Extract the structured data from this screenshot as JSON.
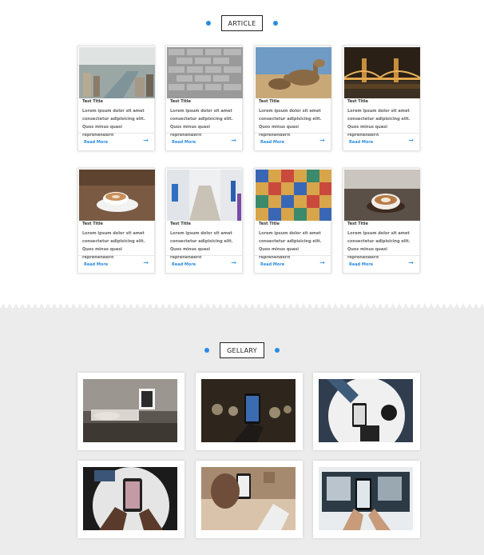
{
  "article_section": {
    "title": "ARTICLE"
  },
  "article_cards": [
    {
      "image": "city-river-photo",
      "title": "Test Title",
      "text": "Lorem ipsum dolor sit amet consectetur adipisicing elit. Quos minus quasi reprehenderit",
      "link": "Read More"
    },
    {
      "image": "brick-wall-photo",
      "title": "Test Title",
      "text": "Lorem ipsum dolor sit amet consectetur adipisicing elit. Quos minus quasi reprehenderit",
      "link": "Read More"
    },
    {
      "image": "camels-desert-photo",
      "title": "Test Title",
      "text": "Lorem ipsum dolor sit amet consectetur adipisicing elit. Quos minus quasi reprehenderit",
      "link": "Read More"
    },
    {
      "image": "bridge-night-photo",
      "title": "Test Title",
      "text": "Lorem ipsum dolor sit amet consectetur adipisicing elit. Quos minus quasi reprehenderit",
      "link": "Read More"
    },
    {
      "image": "coffee-cup-photo",
      "title": "Test Title",
      "text": "Lorem ipsum dolor sit amet consectetur adipisicing elit. Quos minus quasi reprehenderit",
      "link": "Read More"
    },
    {
      "image": "white-street-photo",
      "title": "Test Title",
      "text": "Lorem ipsum dolor sit amet consectetur adipisicing elit. Quos minus quasi reprehenderit",
      "link": "Read More"
    },
    {
      "image": "mosaic-tiles-photo",
      "title": "Test Title",
      "text": "Lorem ipsum dolor sit amet consectetur adipisicing elit. Quos minus quasi reprehenderit",
      "link": "Read More"
    },
    {
      "image": "latte-art-photo",
      "title": "Test Title",
      "text": "Lorem ipsum dolor sit amet consectetur adipisicing elit. Quos minus quasi reprehenderit",
      "link": "Read More"
    }
  ],
  "gallery_section": {
    "title": "GELLARY"
  },
  "gallery_images": [
    "desk-laptop-photo",
    "phone-bokeh-photo",
    "phone-table-top-photo",
    "phone-hands-photo",
    "phones-cafe-photo",
    "phone-monitor-photo"
  ],
  "colors": {
    "accent": "#2a8be0",
    "gallery_bg": "#ececec"
  }
}
